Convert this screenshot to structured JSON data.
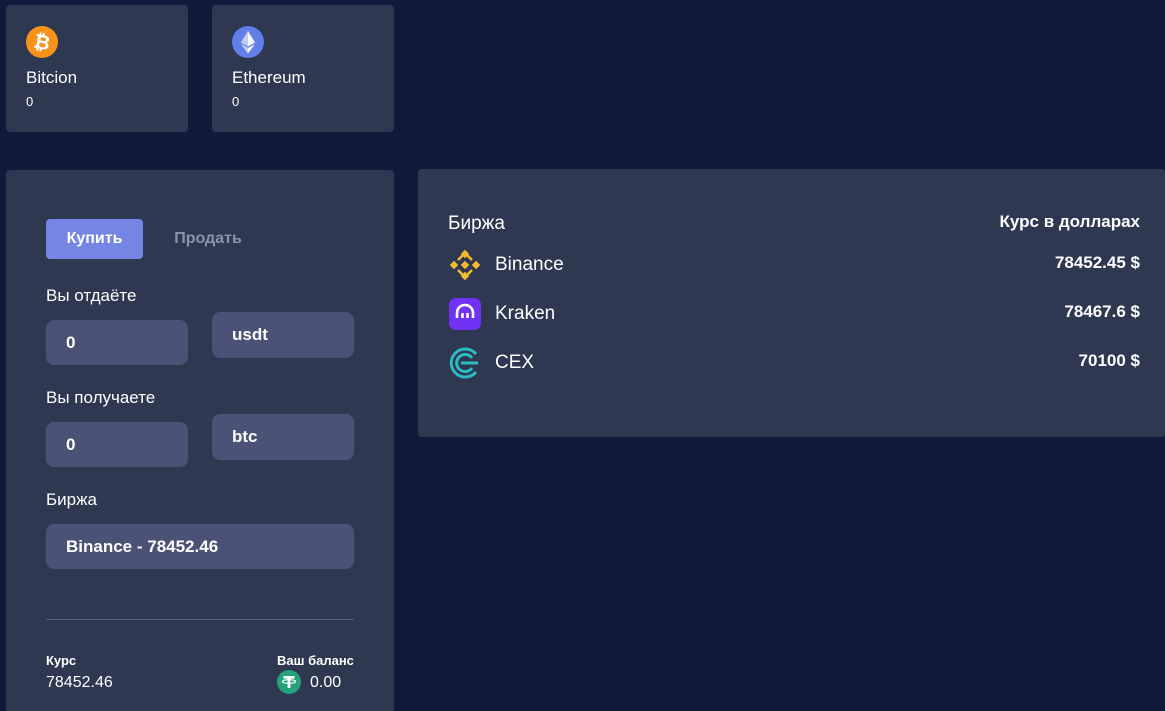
{
  "coins": [
    {
      "name": "Bitcion",
      "amount": "0",
      "icon": "bitcoin-icon",
      "color": "#f7931a"
    },
    {
      "name": "Ethereum",
      "amount": "0",
      "icon": "ethereum-icon",
      "color": "#627eea"
    }
  ],
  "trade": {
    "tab_buy": "Купить",
    "tab_sell": "Продать",
    "give_label": "Вы отдаёте",
    "give_value": "0",
    "give_currency": "usdt",
    "receive_label": "Вы получаете",
    "receive_value": "0",
    "receive_currency": "btc",
    "exchange_label": "Биржа",
    "exchange_value": "Binance - 78452.46",
    "rate_label": "Курс",
    "rate_value": "78452.46",
    "balance_label": "Ваш баланс",
    "balance_value": "0.00",
    "balance_icon": "tether-icon"
  },
  "exchanges": {
    "header_name": "Биржа",
    "header_rate": "Курс в долларах",
    "rows": [
      {
        "name": "Binance",
        "rate": "78452.45 $",
        "icon": "binance-icon",
        "color": "#f3ba2f"
      },
      {
        "name": "Kraken",
        "rate": "78467.6 $",
        "icon": "kraken-icon",
        "color": "#7132f5"
      },
      {
        "name": "CEX",
        "rate": "70100 $",
        "icon": "cex-icon",
        "color": "#2bbbc1"
      }
    ]
  },
  "colors": {
    "background": "#111a3b",
    "panel": "#2e3851",
    "field": "#4a5275",
    "accent": "#7585e3"
  }
}
